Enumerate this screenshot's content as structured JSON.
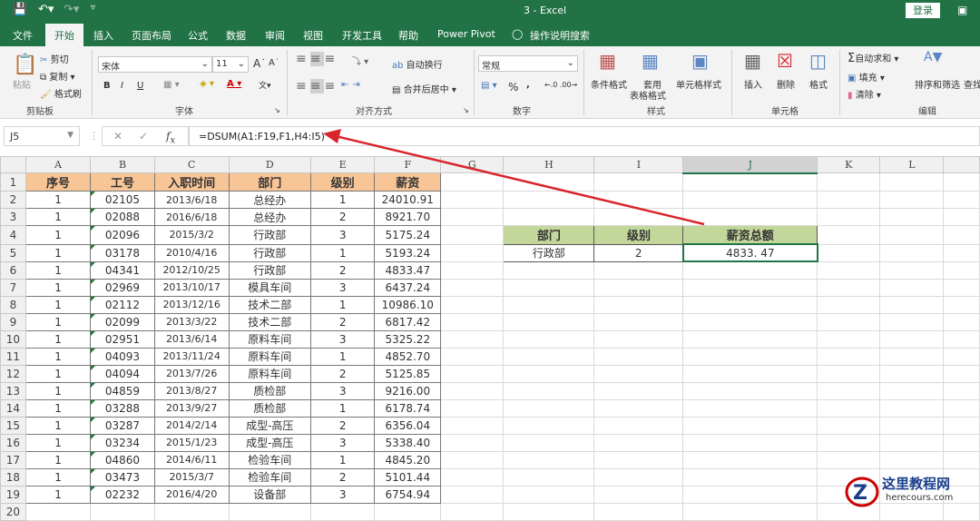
{
  "window": {
    "title": "3  -  Excel",
    "login": "登录"
  },
  "tabs": [
    "文件",
    "开始",
    "插入",
    "页面布局",
    "公式",
    "数据",
    "审阅",
    "视图",
    "开发工具",
    "帮助",
    "Power Pivot",
    "操作说明搜索"
  ],
  "ribbon": {
    "clipboard": {
      "paste": "粘贴",
      "cut": "剪切",
      "copy": "复制",
      "format_painter": "格式刷",
      "group": "剪贴板"
    },
    "font": {
      "name": "宋体",
      "size": "11",
      "bold": "B",
      "italic": "I",
      "underline": "U",
      "group": "字体"
    },
    "alignment": {
      "wrap": "自动换行",
      "merge": "合并后居中",
      "group": "对齐方式"
    },
    "number": {
      "format": "常规",
      "percent": "%",
      "comma": ",",
      "group": "数字"
    },
    "styles": {
      "conditional": "条件格式",
      "table_format": "套用\n表格格式",
      "table_format_1": "套用",
      "table_format_2": "表格格式",
      "cell_styles": "单元格样式",
      "group": "样式"
    },
    "cells": {
      "insert": "插入",
      "delete": "删除",
      "format": "格式",
      "group": "单元格"
    },
    "editing": {
      "autosum": "自动求和",
      "fill": "填充",
      "clear": "清除",
      "sort_filter": "排序和筛选",
      "find": "查找",
      "group": "编辑"
    }
  },
  "formula_bar": {
    "name_box": "J5",
    "formula": "=DSUM(A1:F19,F1,H4:I5)"
  },
  "columns": [
    "A",
    "B",
    "C",
    "D",
    "E",
    "F",
    "G",
    "H",
    "I",
    "J",
    "K",
    "L"
  ],
  "table": {
    "headers": [
      "序号",
      "工号",
      "入职时间",
      "部门",
      "级别",
      "薪资"
    ],
    "rows": [
      [
        "1",
        "02105",
        "2013/6/18",
        "总经办",
        "1",
        "24010.91"
      ],
      [
        "1",
        "02088",
        "2016/6/18",
        "总经办",
        "2",
        "8921.70"
      ],
      [
        "1",
        "02096",
        "2015/3/2",
        "行政部",
        "3",
        "5175.24"
      ],
      [
        "1",
        "03178",
        "2010/4/16",
        "行政部",
        "1",
        "5193.24"
      ],
      [
        "1",
        "04341",
        "2012/10/25",
        "行政部",
        "2",
        "4833.47"
      ],
      [
        "1",
        "02969",
        "2013/10/17",
        "模具车间",
        "3",
        "6437.24"
      ],
      [
        "1",
        "02112",
        "2013/12/16",
        "技术二部",
        "1",
        "10986.10"
      ],
      [
        "1",
        "02099",
        "2013/3/22",
        "技术二部",
        "2",
        "6817.42"
      ],
      [
        "1",
        "02951",
        "2013/6/14",
        "原料车间",
        "3",
        "5325.22"
      ],
      [
        "1",
        "04093",
        "2013/11/24",
        "原料车间",
        "1",
        "4852.70"
      ],
      [
        "1",
        "04094",
        "2013/7/26",
        "原料车间",
        "2",
        "5125.85"
      ],
      [
        "1",
        "04859",
        "2013/8/27",
        "质检部",
        "3",
        "9216.00"
      ],
      [
        "1",
        "03288",
        "2013/9/27",
        "质检部",
        "1",
        "6178.74"
      ],
      [
        "1",
        "03287",
        "2014/2/14",
        "成型-高压",
        "2",
        "6356.04"
      ],
      [
        "1",
        "03234",
        "2015/1/23",
        "成型-高压",
        "3",
        "5338.40"
      ],
      [
        "1",
        "04860",
        "2014/6/11",
        "检验车间",
        "1",
        "4845.20"
      ],
      [
        "1",
        "03473",
        "2015/3/7",
        "检验车间",
        "2",
        "5101.44"
      ],
      [
        "1",
        "02232",
        "2016/4/20",
        "设备部",
        "3",
        "6754.94"
      ]
    ]
  },
  "criteria": {
    "headers": [
      "部门",
      "级别",
      "薪资总额"
    ],
    "values": [
      "行政部",
      "2",
      "4833. 47"
    ]
  },
  "colors": {
    "excel_green": "#217346",
    "header_orange": "#f8c597",
    "criteria_green": "#c4d79b",
    "arrow_red": "#d9262c"
  },
  "watermark": {
    "name": "这里教程网",
    "url": "herecours.com"
  }
}
